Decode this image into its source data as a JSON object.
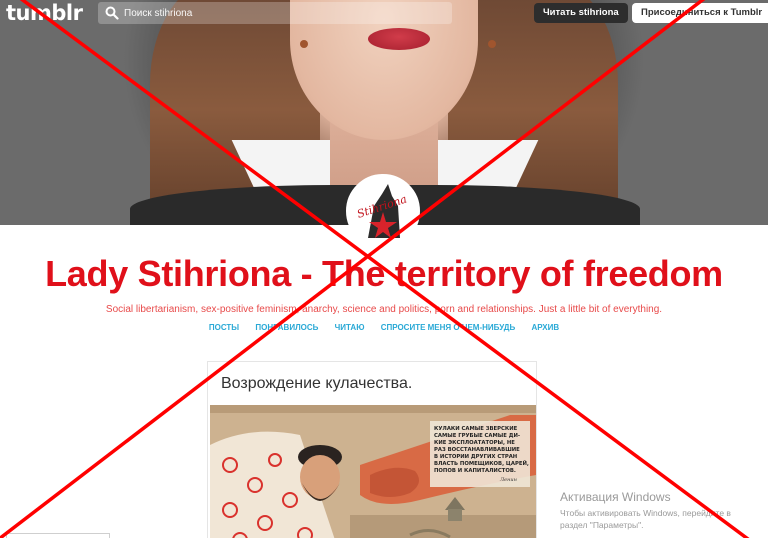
{
  "topbar": {
    "logo": "tumblr",
    "search_placeholder": "Поиск stihriona",
    "follow_label": "Читать stihriona",
    "join_label": "Присоединиться к Tumblr"
  },
  "avatar": {
    "text": "Stihriona"
  },
  "blog": {
    "title": "Lady Stihriona - The territory of freedom",
    "description": "Social libertarianism, sex-positive feminism, anarchy, science and politics, porn and relationships. Just a little bit of everything.",
    "nav": [
      "ПОСТЫ",
      "ПОНРАВИЛОСЬ",
      "ЧИТАЮ",
      "СПРОСИТЕ МЕНЯ О ЧЕМ-НИБУДЬ",
      "АРХИВ"
    ]
  },
  "post": {
    "title": "Возрождение кулачества.",
    "poster_text": [
      "КУЛАКИ САМЫЕ ЗВЕРСКИЕ",
      "САМЫЕ ГРУБЫЕ САМЫЕ ДИ-",
      "КИЕ ЭКСПЛОАТАТОРЫ, НЕ",
      "РАЗ ВОССТАНАВЛИВАВШИЕ",
      "В ИСТОРИИ ДРУГИХ СТРАН",
      "ВЛАСТЬ ПОМЕЩИКОВ, ЦАРЕЙ,",
      "ПОПОВ И КАПИТАЛИСТОВ.",
      "Ленин"
    ]
  },
  "windows": {
    "line1": "Активация Windows",
    "line2": "Чтобы активировать Windows, перейдите в",
    "line3": "раздел \"Параметры\"."
  },
  "colors": {
    "title_red": "#e0101a",
    "nav_blue": "#2aa9d6",
    "cross_red": "#ff0000"
  }
}
